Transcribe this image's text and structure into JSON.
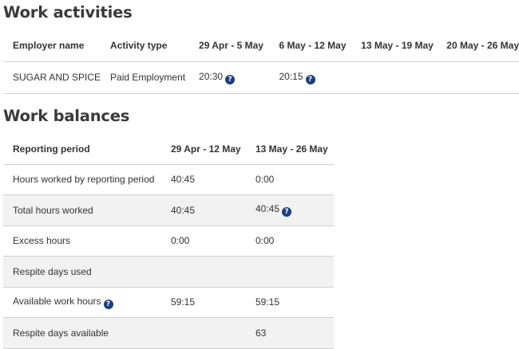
{
  "work_activities": {
    "heading": "Work activities",
    "columns": [
      "Employer name",
      "Activity type",
      "29 Apr - 5 May",
      "6 May - 12 May",
      "13 May - 19 May",
      "20 May - 26 May"
    ],
    "rows": [
      {
        "employer": "SUGAR AND SPICE",
        "activity_type": "Paid Employment",
        "period_1": "20:30",
        "period_1_icon": "help-icon",
        "period_2": "20:15",
        "period_2_icon": "help-icon",
        "period_3": "",
        "period_4": ""
      }
    ]
  },
  "work_balances": {
    "heading": "Work balances",
    "columns": [
      "Reporting period",
      "29 Apr - 12 May",
      "13 May - 26 May"
    ],
    "rows": [
      {
        "label": "Hours worked by reporting period",
        "period_1": "40:45",
        "period_2": "0:00"
      },
      {
        "label": "Total hours worked",
        "period_1": "40:45",
        "period_2": "40:45",
        "period_2_icon": "help-icon"
      },
      {
        "label": "Excess hours",
        "period_1": "0:00",
        "period_2": "0:00"
      },
      {
        "label": "Respite days used",
        "period_1": "",
        "period_2": ""
      },
      {
        "label": "Available work hours",
        "label_icon": "help-icon",
        "period_1": "59:15",
        "period_2": "59:15"
      },
      {
        "label": "Respite days available",
        "period_1": "",
        "period_2": "63"
      }
    ]
  },
  "icons": {
    "help_glyph": "?"
  },
  "colors": {
    "help_icon": "#1d3f7a",
    "stripe": "#f2f2f2",
    "border": "#cfcfcf",
    "text": "#333333"
  }
}
